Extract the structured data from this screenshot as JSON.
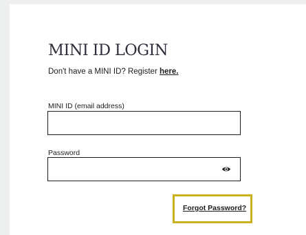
{
  "login": {
    "title": "MINI ID LOGIN",
    "register_prompt": "Don't have a MINI ID? Register",
    "register_link": "here.",
    "email_label": "MINI ID (email address)",
    "email_value": "",
    "password_label": "Password",
    "password_value": "",
    "forgot_link": "Forgot Password?"
  },
  "icons": {
    "show_password": "eye-icon"
  },
  "colors": {
    "highlight_border": "#c9b21c",
    "page_background": "#eef0ef",
    "card_background": "#ffffff",
    "text": "#1b1b1b"
  }
}
